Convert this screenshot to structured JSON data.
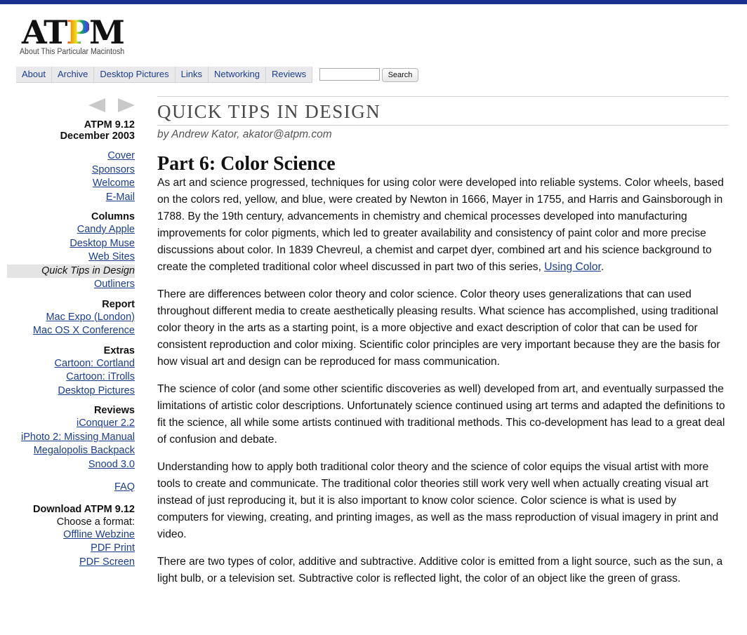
{
  "logo": {
    "mark_a": "AT",
    "mark_p": "P",
    "mark_m": "M",
    "tagline": "About This Particular Macintosh"
  },
  "nav": {
    "items": [
      "About",
      "Archive",
      "Desktop Pictures",
      "Links",
      "Networking",
      "Reviews"
    ],
    "search_button": "Search",
    "search_value": ""
  },
  "sidebar": {
    "issue_line1": "ATPM 9.12",
    "issue_line2": "December 2003",
    "top_links": [
      "Cover",
      "Sponsors",
      "Welcome",
      "E-Mail"
    ],
    "columns": {
      "heading": "Columns",
      "items": [
        "Candy Apple",
        "Desktop Muse",
        "Web Sites",
        "Quick Tips in Design",
        "Outliners"
      ],
      "current": "Quick Tips in Design"
    },
    "report": {
      "heading": "Report",
      "items": [
        "Mac Expo (London)",
        "Mac OS X Conference"
      ]
    },
    "extras": {
      "heading": "Extras",
      "items": [
        "Cartoon: Cortland",
        "Cartoon: iTrolls",
        "Desktop Pictures"
      ]
    },
    "reviews": {
      "heading": "Reviews",
      "items": [
        "iConquer 2.2",
        "iPhoto 2: Missing Manual",
        "Megalopolis Backpack",
        "Snood 3.0"
      ]
    },
    "faq": "FAQ",
    "download": {
      "heading": "Download ATPM 9.12",
      "subhead": "Choose a format:",
      "items": [
        "Offline Webzine",
        "PDF Print",
        "PDF Screen"
      ]
    }
  },
  "article": {
    "column_title": "QUICK TIPS IN DESIGN",
    "byline": "by Andrew Kator, akator@atpm.com",
    "part_title": "Part 6: Color Science",
    "p1_text": "As art and science progressed, techniques for using color were developed into reliable systems. Color wheels, based on the colors red, yellow, and blue, were created by Newton in 1666, Mayer in 1755, and Harris and Gainsborough in 1788. By the 19th century, advancements in chemistry and chemical processes developed into manufacturing improvements for color pigments, which led to greater availability and consistency of paint color and more precise discussions about color. In 1839 Chevreul, a chemist and carpet dyer, combined art and his science background to create the completed traditional color wheel discussed in part two of this series, ",
    "p1_link": "Using Color",
    "p1_end": ".",
    "p2": "There are differences between color theory and color science. Color theory uses generalizations that can used throughout different media to create aesthetically pleasing results. What science has accomplished, using traditional color theory in the arts as a starting point, is a more objective and exact description of color that can be used for consistent reproduction and color mixing. Scientific color principles are very important because they are the basis for how visual art and design can be reproduced for mass communication.",
    "p3": "The science of color (and some other scientific discoveries as well) developed from art, and eventually surpassed the limitations of artistic color descriptions. Unfortunately science continued using art terms and adapted the definitions to fit the science, all while some artists continued with traditional methods. This co-development has lead to a great deal of confusion and debate.",
    "p4": "Understanding how to apply both traditional color theory and the science of color equips the visual artist with more tools to create and communicate. The traditional color theories still work very well when actually creating visual art instead of just reproducing it, but it is also important to know color science. Color science is what is used by computers for viewing, creating, and printing images, as well as the mass reproduction of visual imagery in print and video.",
    "p5": "There are two types of color, additive and subtractive. Additive color is emitted from a light source, such as the sun, a light bulb, or a television set. Subtractive color is reflected light, the color of an object like the green of grass."
  },
  "colors": {
    "link": "#1a3d8f",
    "top_bar": "#1b2f8f",
    "title_gray": "#4a4a4a"
  }
}
